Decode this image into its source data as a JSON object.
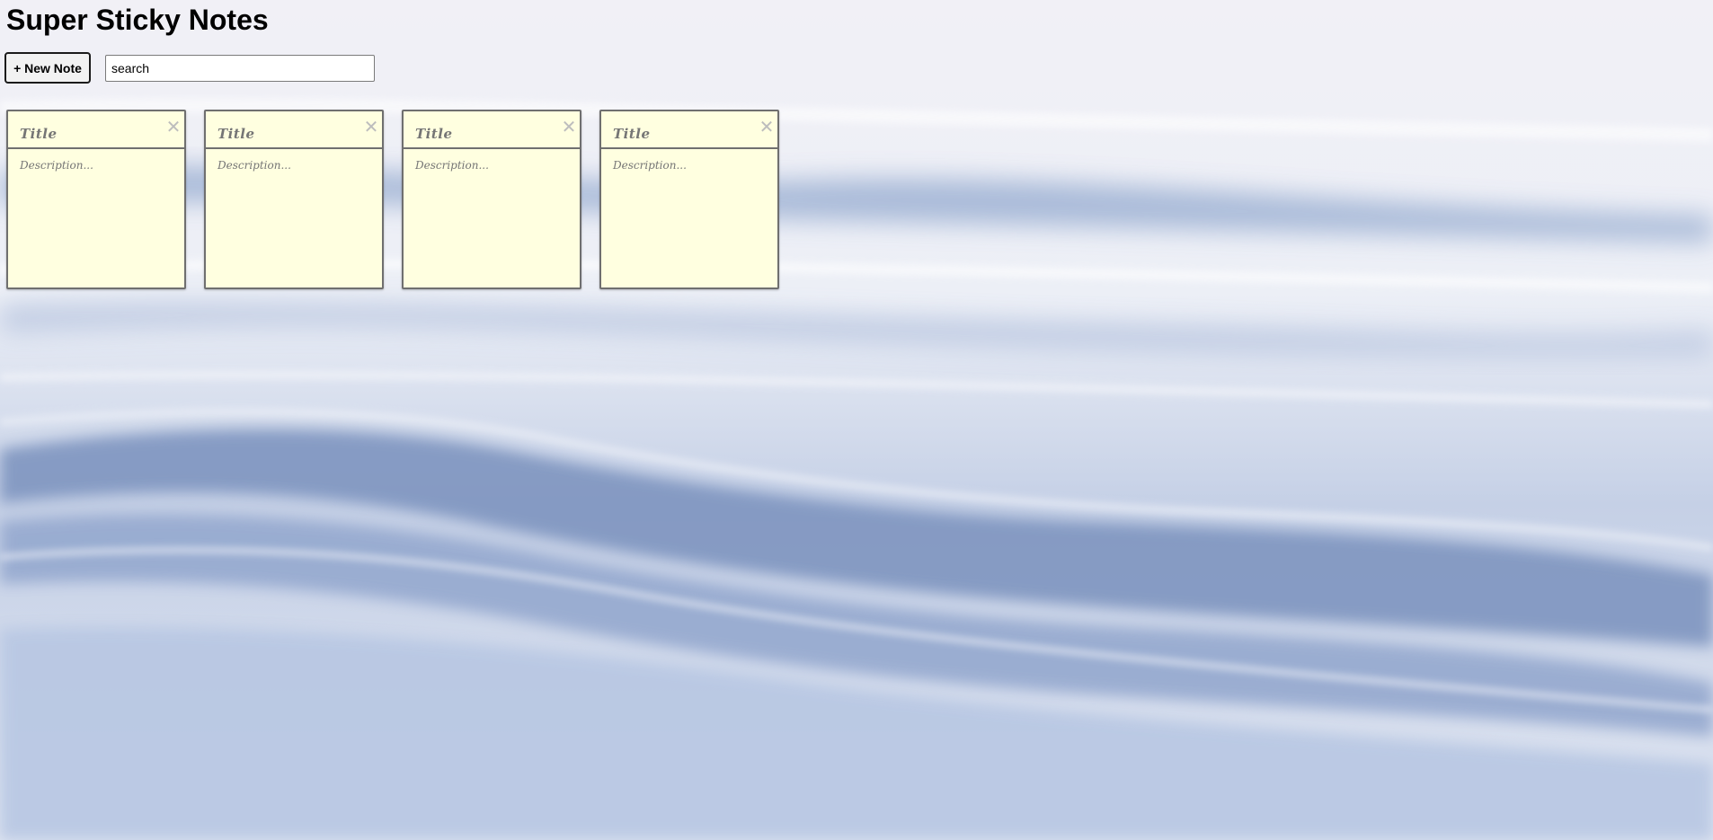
{
  "app": {
    "title": "Super Sticky Notes"
  },
  "toolbar": {
    "new_note_label": "+ New Note",
    "search_value": "search"
  },
  "notes": [
    {
      "title_placeholder": "Title",
      "description_placeholder": "Description...",
      "close_glyph": "✕"
    },
    {
      "title_placeholder": "Title",
      "description_placeholder": "Description...",
      "close_glyph": "✕"
    },
    {
      "title_placeholder": "Title",
      "description_placeholder": "Description...",
      "close_glyph": "✕"
    },
    {
      "title_placeholder": "Title",
      "description_placeholder": "Description...",
      "close_glyph": "✕"
    }
  ],
  "colors": {
    "note_background": "#ffffe0",
    "note_border": "#6f6f6f",
    "background_wave": "#8fa3c8"
  }
}
